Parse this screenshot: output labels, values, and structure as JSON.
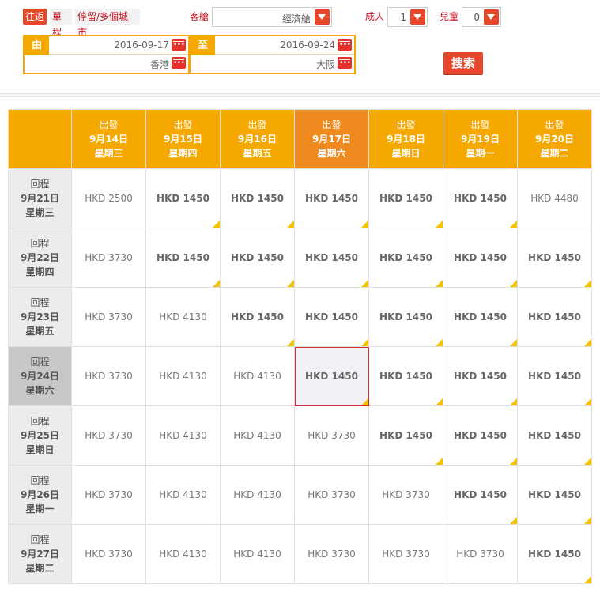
{
  "trip_types": [
    {
      "label": "往返",
      "active": true
    },
    {
      "label": "單程",
      "active": false
    },
    {
      "label": "停留/多個城市",
      "active": false
    }
  ],
  "cabin": {
    "label": "客艙",
    "value": "經濟艙"
  },
  "adults": {
    "label": "成人",
    "value": "1"
  },
  "children": {
    "label": "兒童",
    "value": "0"
  },
  "from": {
    "tag": "由",
    "date": "2016-09-17",
    "city": "香港"
  },
  "to": {
    "tag": "至",
    "date": "2016-09-24",
    "city": "大阪"
  },
  "search_label": "搜索",
  "colors": {
    "accent": "#f5a800",
    "brand_red": "#e8462b",
    "selected_col": "#ef8a1e",
    "low_fare_marker": "#f5c200"
  },
  "grid": {
    "columns": [
      {
        "title": "出發",
        "date": "9月14日",
        "weekday": "星期三",
        "selected": false
      },
      {
        "title": "出發",
        "date": "9月15日",
        "weekday": "星期四",
        "selected": false
      },
      {
        "title": "出發",
        "date": "9月16日",
        "weekday": "星期五",
        "selected": false
      },
      {
        "title": "出發",
        "date": "9月17日",
        "weekday": "星期六",
        "selected": true
      },
      {
        "title": "出發",
        "date": "9月18日",
        "weekday": "星期日",
        "selected": false
      },
      {
        "title": "出發",
        "date": "9月19日",
        "weekday": "星期一",
        "selected": false
      },
      {
        "title": "出發",
        "date": "9月20日",
        "weekday": "星期二",
        "selected": false
      }
    ],
    "rows": [
      {
        "title": "回程",
        "date": "9月21日",
        "weekday": "星期三",
        "selected": false,
        "fares": [
          {
            "price": "HKD 2500",
            "low": false
          },
          {
            "price": "HKD 1450",
            "low": true
          },
          {
            "price": "HKD 1450",
            "low": true
          },
          {
            "price": "HKD 1450",
            "low": true
          },
          {
            "price": "HKD 1450",
            "low": true
          },
          {
            "price": "HKD 1450",
            "low": true
          },
          {
            "price": "HKD 4480",
            "low": false
          }
        ]
      },
      {
        "title": "回程",
        "date": "9月22日",
        "weekday": "星期四",
        "selected": false,
        "fares": [
          {
            "price": "HKD 3730",
            "low": false
          },
          {
            "price": "HKD 1450",
            "low": true
          },
          {
            "price": "HKD 1450",
            "low": true
          },
          {
            "price": "HKD 1450",
            "low": true
          },
          {
            "price": "HKD 1450",
            "low": true
          },
          {
            "price": "HKD 1450",
            "low": true
          },
          {
            "price": "HKD 1450",
            "low": true
          }
        ]
      },
      {
        "title": "回程",
        "date": "9月23日",
        "weekday": "星期五",
        "selected": false,
        "fares": [
          {
            "price": "HKD 3730",
            "low": false
          },
          {
            "price": "HKD 4130",
            "low": false
          },
          {
            "price": "HKD 1450",
            "low": true
          },
          {
            "price": "HKD 1450",
            "low": true
          },
          {
            "price": "HKD 1450",
            "low": true
          },
          {
            "price": "HKD 1450",
            "low": true
          },
          {
            "price": "HKD 1450",
            "low": true
          }
        ]
      },
      {
        "title": "回程",
        "date": "9月24日",
        "weekday": "星期六",
        "selected": true,
        "fares": [
          {
            "price": "HKD 3730",
            "low": false
          },
          {
            "price": "HKD 4130",
            "low": false
          },
          {
            "price": "HKD 4130",
            "low": false
          },
          {
            "price": "HKD 1450",
            "low": true,
            "selected": true
          },
          {
            "price": "HKD 1450",
            "low": true
          },
          {
            "price": "HKD 1450",
            "low": true
          },
          {
            "price": "HKD 1450",
            "low": true
          }
        ]
      },
      {
        "title": "回程",
        "date": "9月25日",
        "weekday": "星期日",
        "selected": false,
        "fares": [
          {
            "price": "HKD 3730",
            "low": false
          },
          {
            "price": "HKD 4130",
            "low": false
          },
          {
            "price": "HKD 4130",
            "low": false
          },
          {
            "price": "HKD 3730",
            "low": false
          },
          {
            "price": "HKD 1450",
            "low": true
          },
          {
            "price": "HKD 1450",
            "low": true
          },
          {
            "price": "HKD 1450",
            "low": true
          }
        ]
      },
      {
        "title": "回程",
        "date": "9月26日",
        "weekday": "星期一",
        "selected": false,
        "fares": [
          {
            "price": "HKD 3730",
            "low": false
          },
          {
            "price": "HKD 4130",
            "low": false
          },
          {
            "price": "HKD 4130",
            "low": false
          },
          {
            "price": "HKD 3730",
            "low": false
          },
          {
            "price": "HKD 3730",
            "low": false
          },
          {
            "price": "HKD 1450",
            "low": true
          },
          {
            "price": "HKD 1450",
            "low": true
          }
        ]
      },
      {
        "title": "回程",
        "date": "9月27日",
        "weekday": "星期二",
        "selected": false,
        "fares": [
          {
            "price": "HKD 3730",
            "low": false
          },
          {
            "price": "HKD 4130",
            "low": false
          },
          {
            "price": "HKD 4130",
            "low": false
          },
          {
            "price": "HKD 3730",
            "low": false
          },
          {
            "price": "HKD 3730",
            "low": false
          },
          {
            "price": "HKD 3730",
            "low": false
          },
          {
            "price": "HKD 1450",
            "low": true
          }
        ]
      }
    ]
  }
}
